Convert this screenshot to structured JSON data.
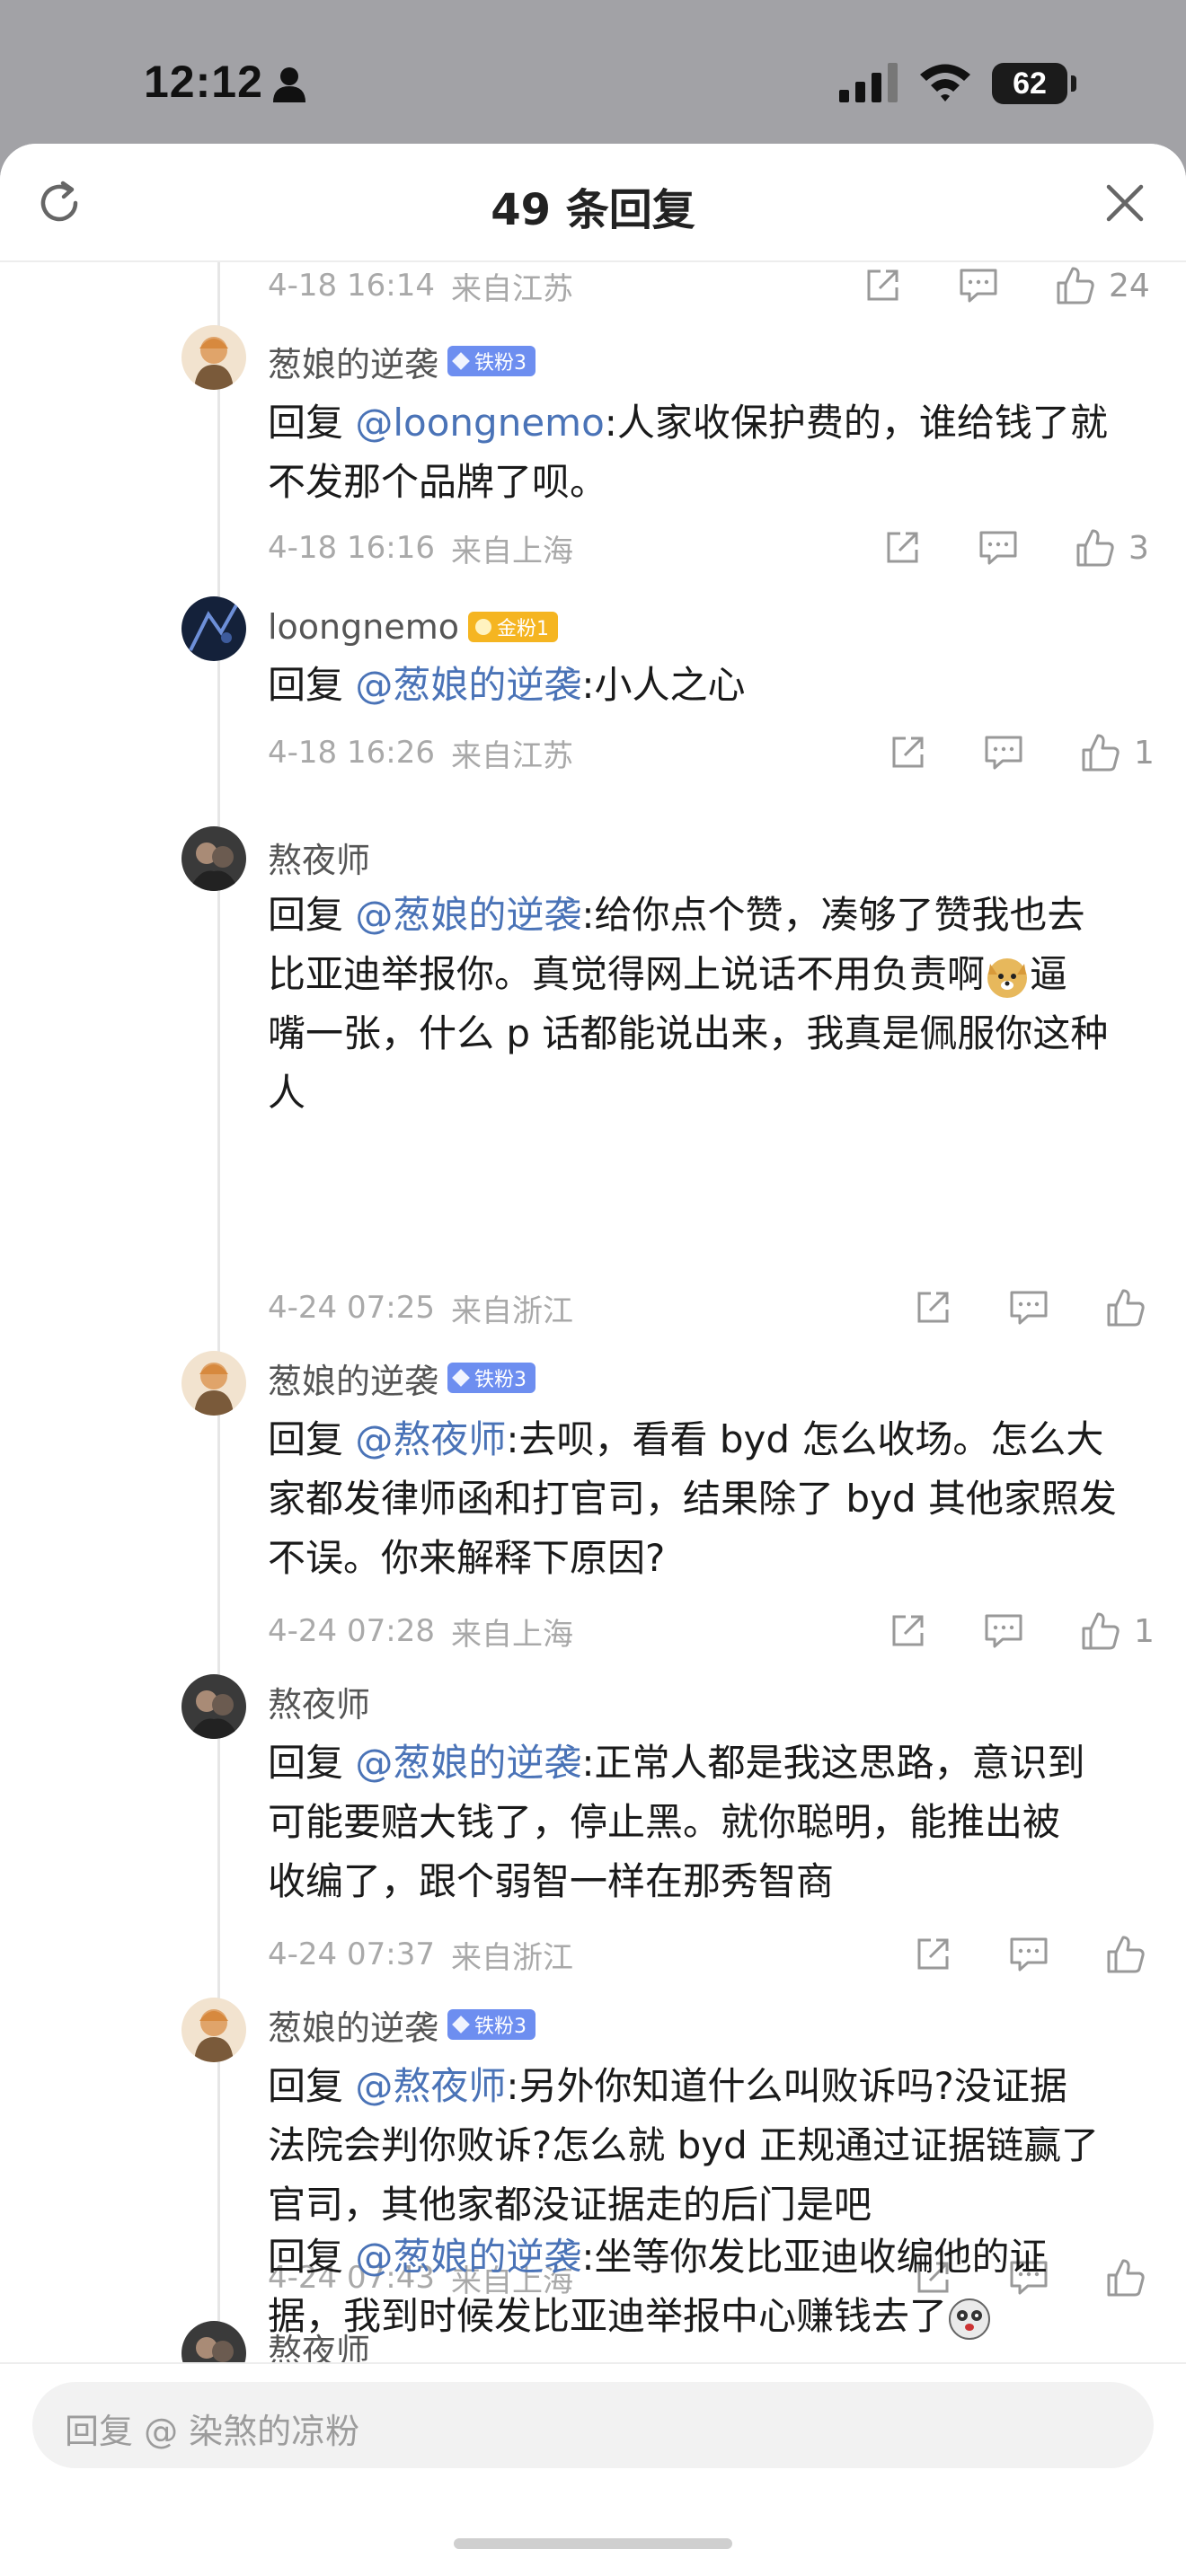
{
  "status_bar": {
    "time": "12:12",
    "battery": "62"
  },
  "header": {
    "title": "49 条回复",
    "refresh_icon": "refresh-icon",
    "close_icon": "close-icon"
  },
  "first_meta": {
    "time": "4-18 16:14",
    "location": "来自江苏",
    "likes": "24"
  },
  "comments": [
    {
      "user": "葱娘的逆袭",
      "badge": "铁粉3",
      "reply_prefix": "回复 ",
      "mention": "@loongnemo",
      "text_lines": [
        ":人家收保护费的，谁给钱了就",
        "不发那个品牌了呗。"
      ],
      "time": "4-18 16:16",
      "location": "来自上海",
      "likes": "3"
    },
    {
      "user": "loongnemo",
      "badge": "金粉1",
      "reply_prefix": "回复 ",
      "mention": "@葱娘的逆袭",
      "text_lines": [
        ":小人之心"
      ],
      "time": "4-18 16:26",
      "location": "来自江苏",
      "likes": "1"
    },
    {
      "user": "熬夜师",
      "badge": "",
      "reply_prefix": "回复 ",
      "mention": "@葱娘的逆袭",
      "text_lines": [
        ":给你点个赞，凑够了赞我也去",
        "比亚迪举报你。真觉得网上说话不用负责啊",
        "逼",
        "嘴一张，什么 p 话都能说出来，我真是佩服你这种",
        "人"
      ],
      "time": "4-24 07:25",
      "location": "来自浙江",
      "likes": ""
    },
    {
      "user": "葱娘的逆袭",
      "badge": "铁粉3",
      "reply_prefix": "回复 ",
      "mention": "@熬夜师",
      "text_lines": [
        ":去呗，看看 byd 怎么收场。怎么大",
        "家都发律师函和打官司，结果除了 byd 其他家照发",
        "不误。你来解释下原因?"
      ],
      "time": "4-24 07:28",
      "location": "来自上海",
      "likes": "1"
    },
    {
      "user": "熬夜师",
      "badge": "",
      "reply_prefix": "回复 ",
      "mention": "@葱娘的逆袭",
      "text_lines": [
        ":正常人都是我这思路，意识到",
        "可能要赔大钱了，停止黑。就你聪明，能推出被",
        "收编了，跟个弱智一样在那秀智商"
      ],
      "time": "4-24 07:37",
      "location": "来自浙江",
      "likes": ""
    },
    {
      "user": "葱娘的逆袭",
      "badge": "铁粉3",
      "reply_prefix": "回复 ",
      "mention": "@熬夜师",
      "text_lines": [
        ":另外你知道什么叫败诉吗?没证据",
        "法院会判你败诉?怎么就 byd 正规通过证据链赢了",
        "官司，其他家都没证据走的后门是吧"
      ],
      "time": "4-24 07:43",
      "location": "来自上海",
      "likes": ""
    },
    {
      "user": "熬夜师",
      "badge": "",
      "reply_prefix": "回复 ",
      "mention": "@葱娘的逆袭",
      "text_lines": [
        ":坐等你发比亚迪收编他的证",
        "据，我到时候发比亚迪举报中心赚钱去了"
      ],
      "time": "",
      "location": "",
      "likes": ""
    }
  ],
  "input": {
    "placeholder": "回复 @ 染煞的凉粉"
  },
  "icons": {
    "share": "share-icon",
    "comment": "comment-icon",
    "like": "thumbs-up-icon"
  },
  "colors": {
    "mention": "#4a73b7",
    "iron_badge": "#6d8ef0",
    "gold_badge": "#f5b521"
  }
}
